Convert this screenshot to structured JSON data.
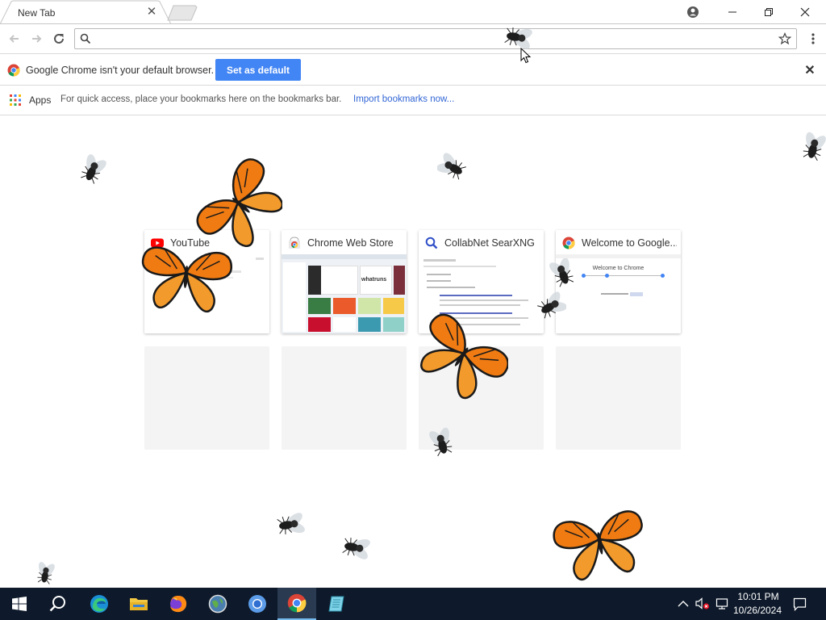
{
  "browser": {
    "tab": {
      "title": "New Tab"
    },
    "omnibox": {
      "value": "",
      "placeholder": ""
    },
    "infobar": {
      "message": "Google Chrome isn't your default browser.",
      "button_label": "Set as default"
    },
    "bookmarks": {
      "apps_label": "Apps",
      "hint": "For quick access, place your bookmarks here on the bookmarks bar.",
      "import_link": "Import bookmarks now..."
    }
  },
  "ntp": {
    "tiles": [
      {
        "title": "YouTube",
        "icon": "youtube-icon"
      },
      {
        "title": "Chrome Web Store",
        "icon": "chrome-web-store-icon"
      },
      {
        "title": "CollabNet SearXNG",
        "icon": "search-icon"
      },
      {
        "title": "Welcome to Google...",
        "icon": "chrome-icon"
      }
    ],
    "thumb_text": {
      "whatruns": "whatruns",
      "welcome": "Welcome to Chrome"
    }
  },
  "taskbar": {
    "apps": [
      "start-icon",
      "search-icon",
      "edge-icon",
      "file-explorer-icon",
      "firefox-icon",
      "app-globe-icon",
      "chromium-icon",
      "chrome-icon",
      "notepad-icon"
    ],
    "clock": {
      "time": "10:01 PM",
      "date": "10/26/2024"
    }
  },
  "colors": {
    "accent": "#4285f4",
    "link": "#3367d6",
    "taskbar": "#0e1a2b"
  }
}
